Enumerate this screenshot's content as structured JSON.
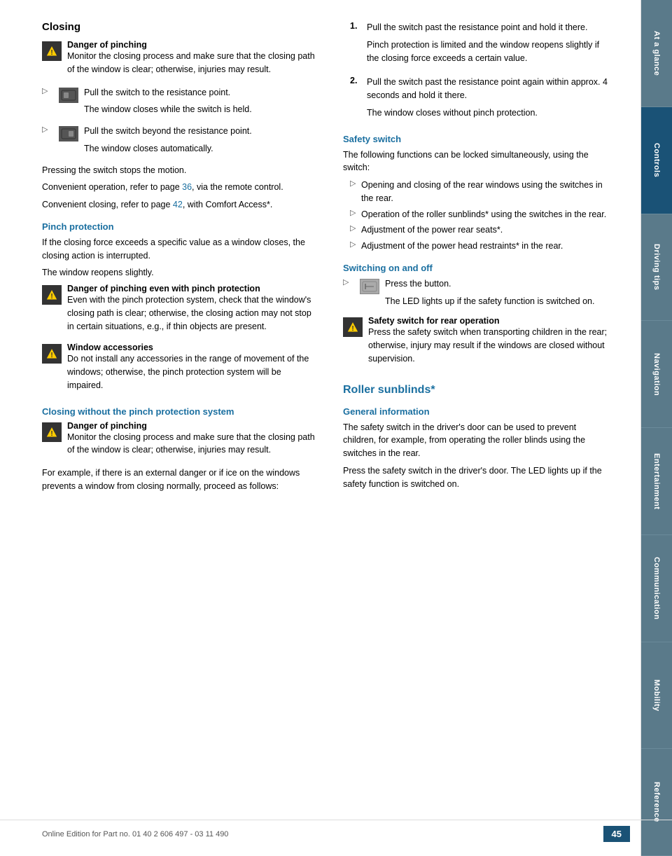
{
  "sidebar": {
    "items": [
      {
        "label": "At a glance",
        "active": false
      },
      {
        "label": "Controls",
        "active": true
      },
      {
        "label": "Driving tips",
        "active": false
      },
      {
        "label": "Navigation",
        "active": false
      },
      {
        "label": "Entertainment",
        "active": false
      },
      {
        "label": "Communication",
        "active": false
      },
      {
        "label": "Mobility",
        "active": false
      },
      {
        "label": "Reference",
        "active": false
      }
    ]
  },
  "left": {
    "main_title": "Closing",
    "warning1": {
      "title": "Danger of pinching",
      "text": "Monitor the closing process and make sure that the closing path of the window is clear; otherwise, injuries may result."
    },
    "action1": {
      "text_main": "Pull the switch to the resistance point.",
      "text_sub": "The window closes while the switch is held."
    },
    "action2": {
      "text_main": "Pull the switch beyond the resistance point.",
      "text_sub": "The window closes automatically."
    },
    "p1": "Pressing the switch stops the motion.",
    "p2_prefix": "Convenient operation, refer to page ",
    "p2_link": "36",
    "p2_suffix": ", via the remote control.",
    "p3_prefix": "Convenient closing, refer to page ",
    "p3_link": "42",
    "p3_suffix": ", with Comfort Access*.",
    "pinch_title": "Pinch protection",
    "pinch_p1": "If the closing force exceeds a specific value as a window closes, the closing action is interrupted.",
    "pinch_p2": "The window reopens slightly.",
    "warning2": {
      "title": "Danger of pinching even with pinch protection",
      "text": "Even with the pinch protection system, check that the window's closing path is clear; otherwise, the closing action may not stop in certain situations, e.g., if thin objects are present."
    },
    "warning3": {
      "title": "Window accessories",
      "text": "Do not install any accessories in the range of movement of the windows; otherwise, the pinch protection system will be impaired."
    },
    "closing_nopinch_title": "Closing without the pinch protection system",
    "warning4": {
      "title": "Danger of pinching",
      "text": "Monitor the closing process and make sure that the closing path of the window is clear; otherwise, injuries may result."
    },
    "p4": "For example, if there is an external danger or if ice on the windows prevents a window from closing normally, proceed as follows:"
  },
  "right": {
    "numbered_items": [
      {
        "num": "1.",
        "text": "Pull the switch past the resistance point and hold it there.",
        "detail": "Pinch protection is limited and the window reopens slightly if the closing force exceeds a certain value."
      },
      {
        "num": "2.",
        "text": "Pull the switch past the resistance point again within approx. 4 seconds and hold it there.",
        "detail": "The window closes without pinch protection."
      }
    ],
    "safety_title": "Safety switch",
    "safety_p1": "The following functions can be locked simultaneously, using the switch:",
    "safety_bullets": [
      "Opening and closing of the rear windows using the switches in the rear.",
      "Operation of the roller sunblinds* using the switches in the rear.",
      "Adjustment of the power rear seats*.",
      "Adjustment of the power head restraints* in the rear."
    ],
    "switching_title": "Switching on and off",
    "switch_action": {
      "text_main": "Press the button.",
      "text_sub": "The LED lights up if the safety function is switched on."
    },
    "warning5": {
      "title": "Safety switch for rear operation",
      "text": "Press the safety switch when transporting children in the rear; otherwise, injury may result if the windows are closed without supervision."
    },
    "roller_title": "Roller sunblinds*",
    "general_title": "General information",
    "general_p1": "The safety switch in the driver's door can be used to prevent children, for example, from operating the roller blinds using the switches in the rear.",
    "general_p2": "Press the safety switch in the driver's door. The LED lights up if the safety function is switched on."
  },
  "footer": {
    "page_number": "45",
    "footer_text": "Online Edition for Part no. 01 40 2 606 497 - 03 11 490"
  }
}
